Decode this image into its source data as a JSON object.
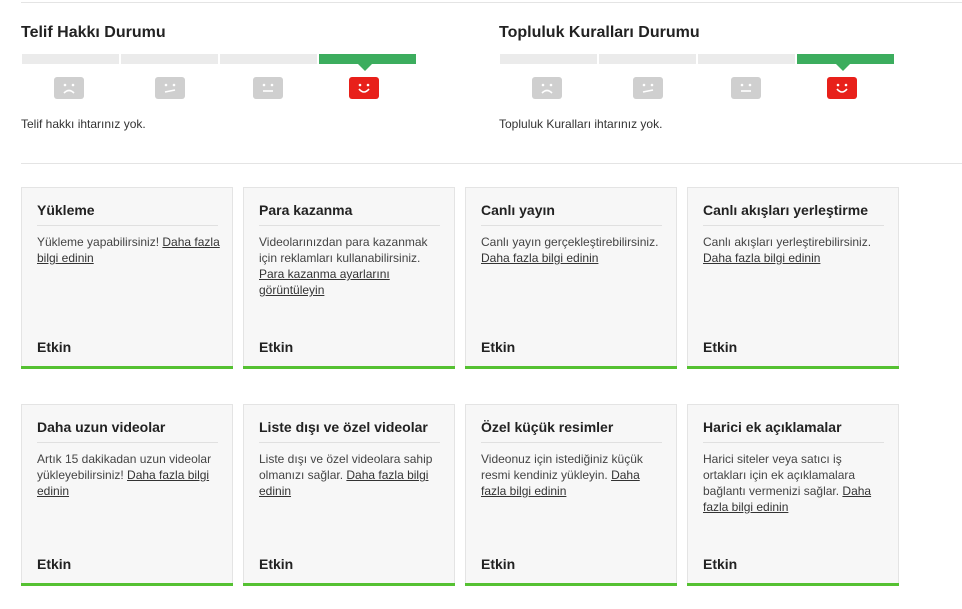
{
  "copyright": {
    "title": "Telif Hakkı Durumu",
    "message": "Telif hakkı ihtarınız yok."
  },
  "community": {
    "title": "Topluluk Kuralları Durumu",
    "message": "Topluluk Kuralları ihtarınız yok."
  },
  "colors": {
    "active_segment": "#3cad5e",
    "good_face": "#e8201a",
    "inactive_face": "#cfcfcf",
    "enabled_bar": "#55c132"
  },
  "cards": [
    {
      "title": "Yükleme",
      "text": "Yükleme yapabilirsiniz! ",
      "link": "Daha fazla bilgi edinin",
      "status": "Etkin"
    },
    {
      "title": "Para kazanma",
      "text": "Videolarınızdan para kazanmak için reklamları kullanabilirsiniz. ",
      "link": "Para kazanma ayarlarını görüntüleyin",
      "status": "Etkin"
    },
    {
      "title": "Canlı yayın",
      "text": "Canlı yayın gerçekleştirebilirsiniz. ",
      "link": "Daha fazla bilgi edinin",
      "status": "Etkin"
    },
    {
      "title": "Canlı akışları yerleştirme",
      "text": "Canlı akışları yerleştirebilirsiniz. ",
      "link": "Daha fazla bilgi edinin",
      "status": "Etkin"
    },
    {
      "title": "Daha uzun videolar",
      "text": "Artık 15 dakikadan uzun videolar yükleyebilirsiniz! ",
      "link": "Daha fazla bilgi edinin",
      "status": "Etkin"
    },
    {
      "title": "Liste dışı ve özel videolar",
      "text": "Liste dışı ve özel videolara sahip olmanızı sağlar. ",
      "link": "Daha fazla bilgi edinin",
      "status": "Etkin"
    },
    {
      "title": "Özel küçük resimler",
      "text": "Videonuz için istediğiniz küçük resmi kendiniz yükleyin. ",
      "link": "Daha fazla bilgi edinin",
      "status": "Etkin"
    },
    {
      "title": "Harici ek açıklamalar",
      "text": "Harici siteler veya satıcı iş ortakları için ek açıklamalara bağlantı vermenizi sağlar. ",
      "link": "Daha fazla bilgi edinin",
      "status": "Etkin"
    }
  ]
}
